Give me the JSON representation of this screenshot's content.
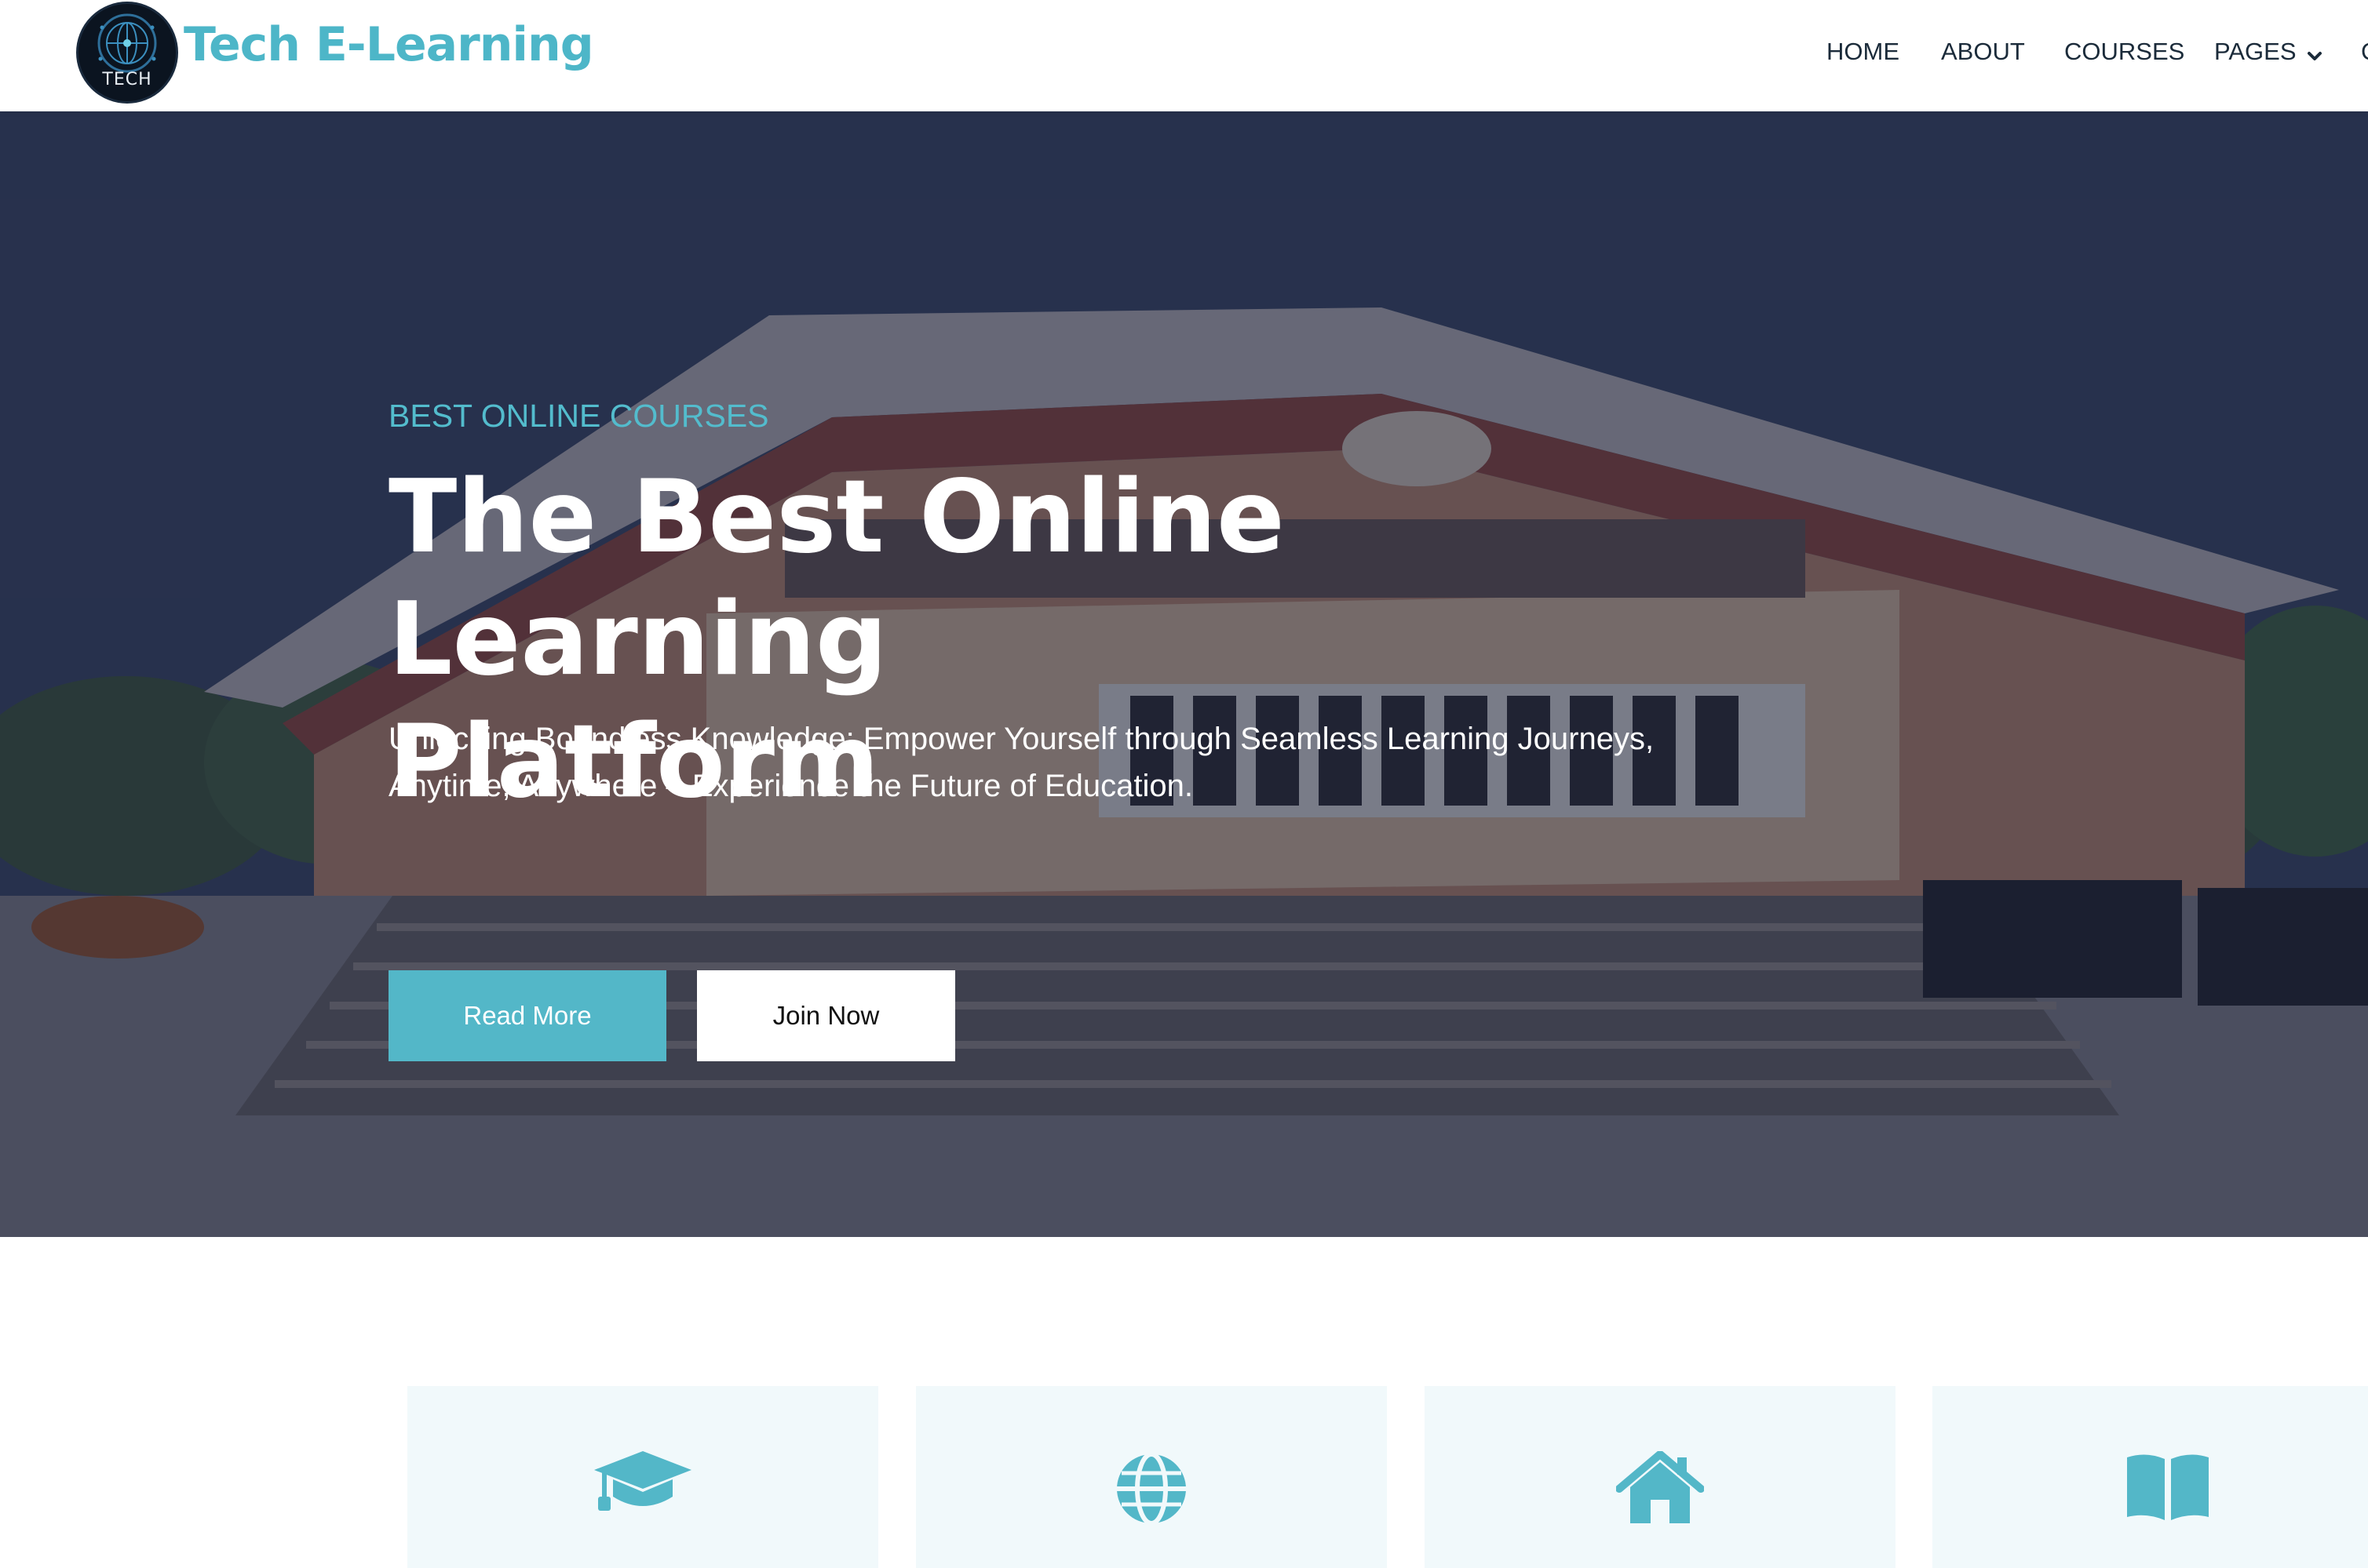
{
  "brand": {
    "name": "Tech E-Learning",
    "logo_text": "TECH",
    "logo_icon": "globe-circuit-logo"
  },
  "nav": {
    "items": [
      {
        "label": "HOME"
      },
      {
        "label": "ABOUT"
      },
      {
        "label": "COURSES"
      },
      {
        "label": "PAGES",
        "icon": "chevron-down-icon"
      },
      {
        "label": "C"
      }
    ]
  },
  "hero": {
    "eyebrow": "BEST ONLINE COURSES",
    "title_line1": "The Best Online Learning",
    "title_line2": "Platform",
    "subtitle_line1": "Unlocking Boundless Knowledge: Empower Yourself through Seamless Learning Journeys,",
    "subtitle_line2": "Anytime, Anywhere – Experience the Future of Education.",
    "read_more_label": "Read More",
    "join_now_label": "Join Now",
    "background": "school-building-photo"
  },
  "features": {
    "cards": [
      {
        "icon": "graduation-cap-icon"
      },
      {
        "icon": "globe-icon"
      },
      {
        "icon": "home-icon"
      },
      {
        "icon": "book-open-icon"
      }
    ]
  },
  "colors": {
    "accent": "#53b7c8",
    "brand_text": "#4db6c8",
    "nav_text": "#1b2b3a",
    "card_bg": "#f1f9fb",
    "hero_overlay": "#181d38"
  }
}
